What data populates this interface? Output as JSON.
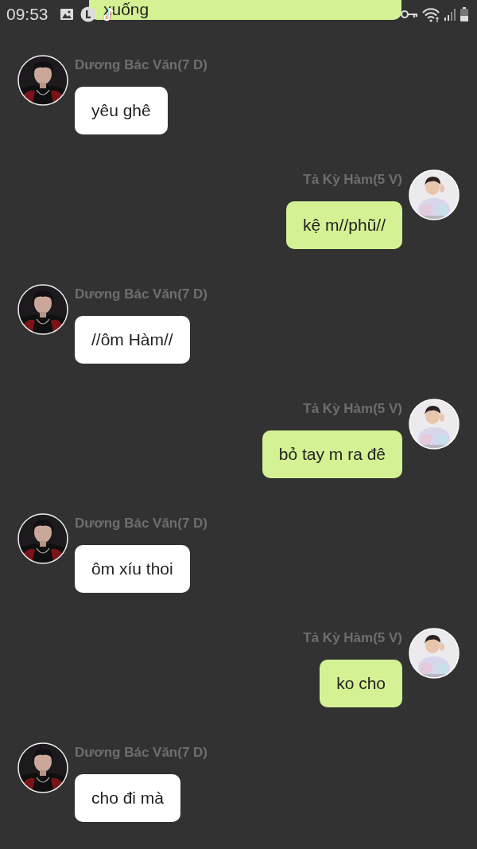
{
  "status_bar": {
    "time": "09:53"
  },
  "messages": [
    {
      "kind": "partial",
      "text": "xuống"
    },
    {
      "kind": "incoming",
      "sender": "Dương Bác Văn(7 D)",
      "text": "yêu ghê"
    },
    {
      "kind": "outgoing",
      "sender": "Tả Kỳ Hàm(5 V)",
      "text": "kệ m//phũ//"
    },
    {
      "kind": "incoming",
      "sender": "Dương Bác Văn(7 D)",
      "text": "//ôm Hàm//"
    },
    {
      "kind": "outgoing",
      "sender": "Tả Kỳ Hàm(5 V)",
      "text": "bỏ tay m ra đê"
    },
    {
      "kind": "incoming",
      "sender": "Dương Bác Văn(7 D)",
      "text": "ôm xíu thoi"
    },
    {
      "kind": "outgoing",
      "sender": "Tả Kỳ Hàm(5 V)",
      "text": "ko cho"
    },
    {
      "kind": "incoming",
      "sender": "Dương Bác Văn(7 D)",
      "text": "cho đi mà"
    }
  ]
}
